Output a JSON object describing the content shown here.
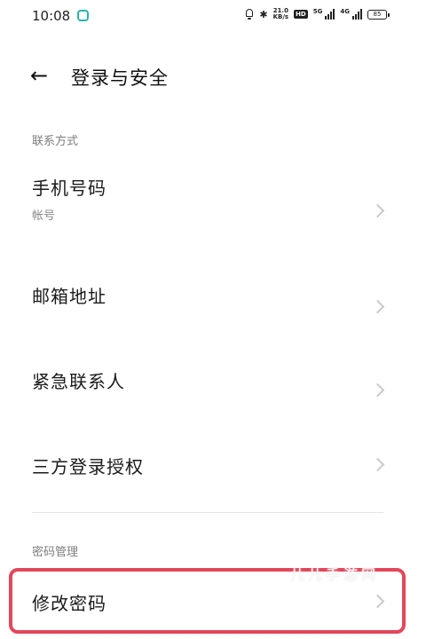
{
  "status_bar": {
    "time": "10:08",
    "speed_top": "21.0",
    "speed_unit": "KB/s",
    "hd_badge": "HD",
    "network_1": "5G",
    "network_2": "4G",
    "battery": "85"
  },
  "header": {
    "back_icon": "arrow-left-icon",
    "title": "登录与安全"
  },
  "sections": {
    "contact": {
      "header": "联系方式",
      "items": [
        {
          "label": "手机号码",
          "sub": "帐号"
        },
        {
          "label": "邮箱地址"
        },
        {
          "label": "紧急联系人"
        },
        {
          "label": "三方登录授权"
        }
      ]
    },
    "password": {
      "header": "密码管理",
      "items": [
        {
          "label": "修改密码"
        }
      ]
    }
  },
  "highlight_color": "#e2475a",
  "watermark": "儿儿手游网"
}
